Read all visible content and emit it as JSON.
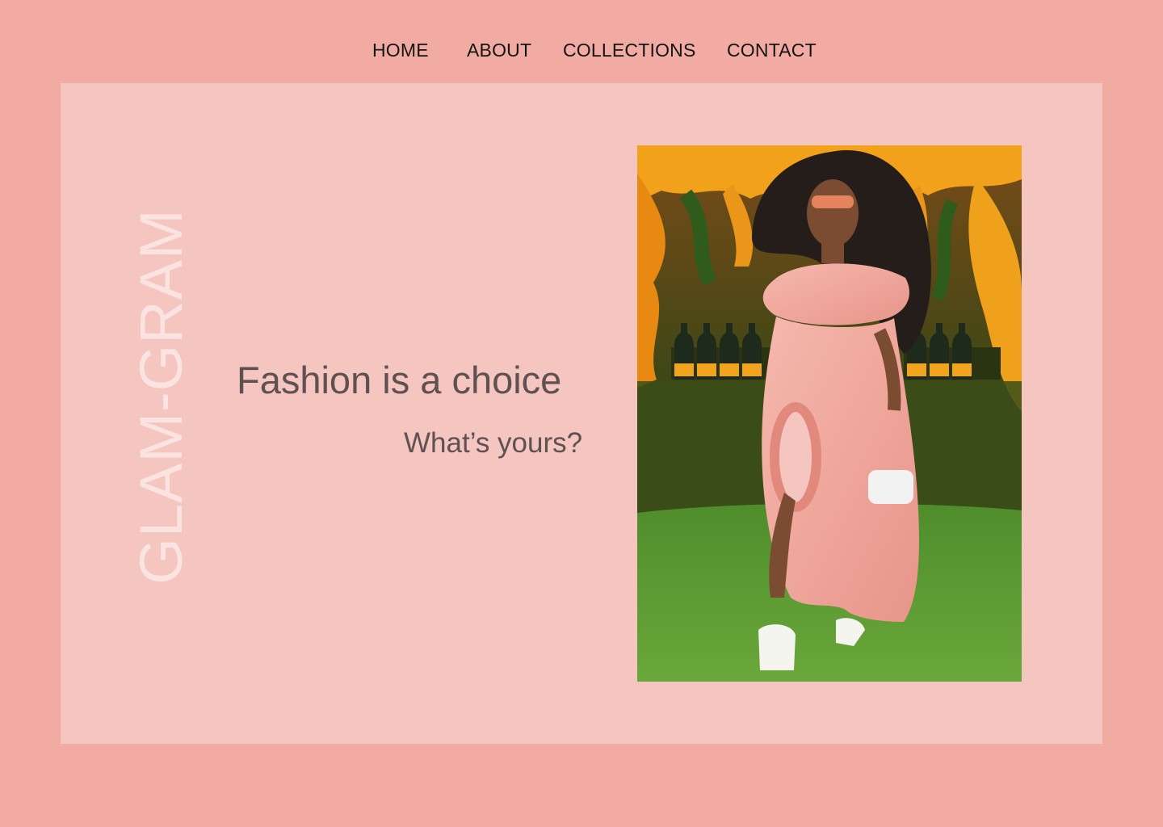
{
  "nav": {
    "items": [
      {
        "label": "HOME"
      },
      {
        "label": "ABOUT"
      },
      {
        "label": "COLLECTIONS"
      },
      {
        "label": "CONTACT"
      }
    ]
  },
  "hero": {
    "brand": "GLAM-GRAM",
    "tagline": "Fashion is a choice",
    "subline": "What’s yours?",
    "photo_description_icon": "fashion-photo"
  },
  "colors": {
    "page_background": "#f2aba3",
    "panel_background": "#f5c5c0",
    "brand_text": "#fbe3e1",
    "headline_text": "#5f5152",
    "nav_text": "#141414"
  }
}
